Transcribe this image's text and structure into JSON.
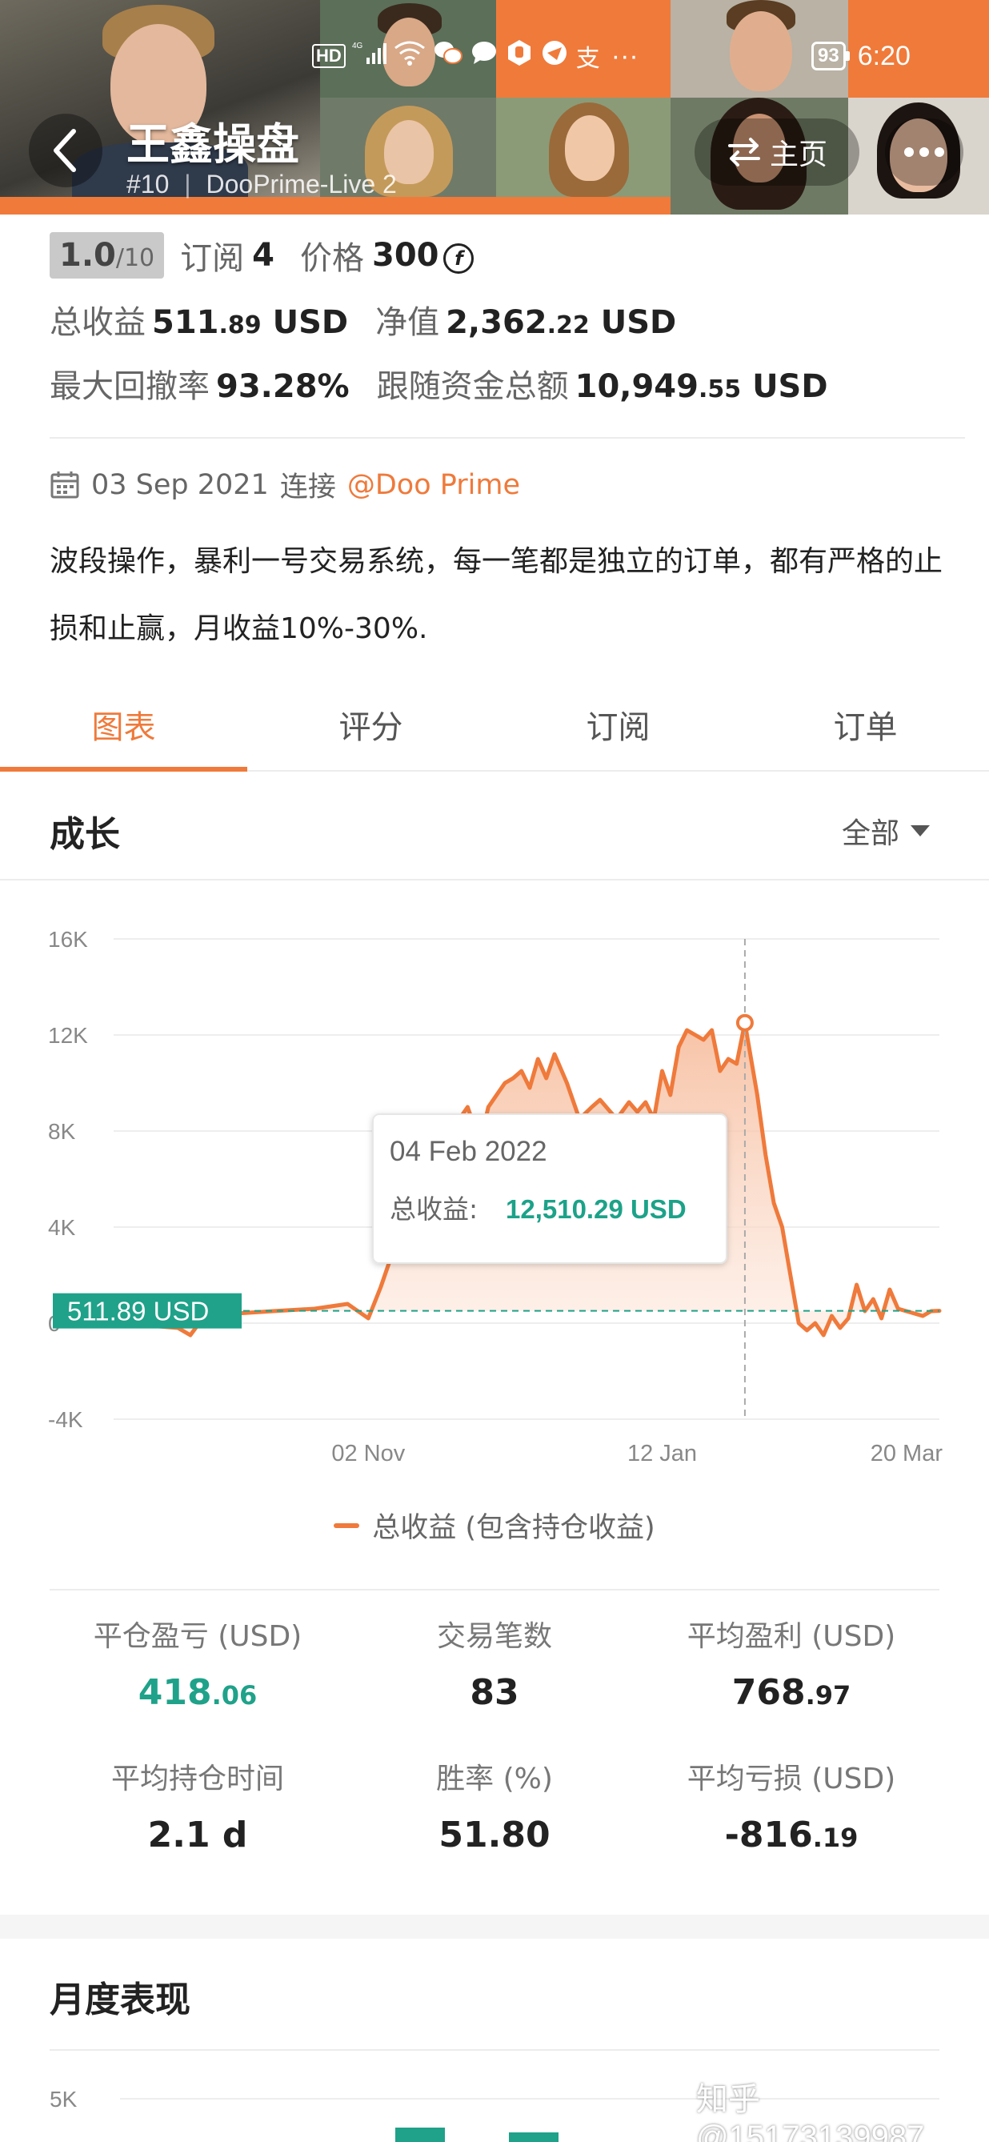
{
  "status_bar": {
    "left_icons": [
      "hd-icon",
      "4g-signal-icon",
      "wifi-icon",
      "wechat-icon",
      "message-icon",
      "hand-icon",
      "app-icon",
      "app-icon",
      "alipay-icon",
      "more-dots-icon"
    ],
    "battery": "93",
    "time": "6:20"
  },
  "header": {
    "name": "王鑫操盘",
    "rank": "#10",
    "account": "DooPrime-Live 2",
    "home_label": "主页"
  },
  "summary": {
    "rating": "1.0",
    "rating_max": "/10",
    "subscribe_label": "订阅",
    "subscribe_count": "4",
    "price_label": "价格",
    "price_value": "300",
    "total_profit_label": "总收益",
    "total_profit_int": "511",
    "total_profit_dec": ".89",
    "total_profit_unit": "USD",
    "net_value_label": "净值",
    "net_value_int": "2,362",
    "net_value_dec": ".22",
    "net_value_unit": "USD",
    "max_drawdown_label": "最大回撤率",
    "max_drawdown_value": "93.28%",
    "follow_total_label": "跟随资金总额",
    "follow_total_int": "10,949",
    "follow_total_dec": ".55",
    "follow_total_unit": "USD"
  },
  "connection": {
    "date": "03 Sep 2021",
    "connect_label": "连接",
    "broker": "@Doo Prime"
  },
  "description": "波段操作，暴利一号交易系统，每一笔都是独立的订单，都有严格的止损和止赢，月收益10%-30%.",
  "tabs": [
    {
      "label": "图表",
      "active": true
    },
    {
      "label": "评分",
      "active": false
    },
    {
      "label": "订阅",
      "active": false
    },
    {
      "label": "订单",
      "active": false
    }
  ],
  "growth": {
    "title": "成长",
    "range": "全部",
    "legend": "总收益 (包含持仓收益)"
  },
  "chart_data": {
    "type": "area",
    "title": "",
    "xlabel": "",
    "ylabel": "",
    "ylim": [
      -4000,
      16000
    ],
    "y_ticks": [
      "16K",
      "12K",
      "8K",
      "4K",
      "0",
      "-4K"
    ],
    "x_tick_labels": [
      "02 Nov",
      "12 Jan",
      "20 Mar"
    ],
    "grid": true,
    "current_value_label": "511.89 USD",
    "current_value": 511.89,
    "tooltip": {
      "date": "04 Feb 2022",
      "label": "总收益:",
      "value": "12,510.29 USD"
    },
    "series": [
      {
        "name": "总收益 (包含持仓收益)",
        "color": "#ef7a3b",
        "x": [
          "2021-09-03",
          "2021-09-10",
          "2021-09-17",
          "2021-09-20",
          "2021-09-23",
          "2021-09-26",
          "2021-10-01",
          "2021-10-10",
          "2021-10-20",
          "2021-10-28",
          "2021-11-02",
          "2021-11-05",
          "2021-11-08",
          "2021-11-12",
          "2021-11-16",
          "2021-11-20",
          "2021-11-22",
          "2021-11-24",
          "2021-11-26",
          "2021-11-29",
          "2021-12-01",
          "2021-12-03",
          "2021-12-05",
          "2021-12-07",
          "2021-12-09",
          "2021-12-11",
          "2021-12-13",
          "2021-12-15",
          "2021-12-17",
          "2021-12-20",
          "2021-12-23",
          "2021-12-26",
          "2021-12-28",
          "2022-01-01",
          "2022-01-04",
          "2022-01-06",
          "2022-01-08",
          "2022-01-10",
          "2022-01-12",
          "2022-01-14",
          "2022-01-16",
          "2022-01-18",
          "2022-01-20",
          "2022-01-22",
          "2022-01-24",
          "2022-01-26",
          "2022-01-28",
          "2022-01-30",
          "2022-02-01",
          "2022-02-04",
          "2022-02-06",
          "2022-02-08",
          "2022-02-10",
          "2022-02-12",
          "2022-02-14",
          "2022-02-16",
          "2022-02-18",
          "2022-02-20",
          "2022-02-22",
          "2022-02-24",
          "2022-02-26",
          "2022-02-28",
          "2022-03-02",
          "2022-03-04",
          "2022-03-06",
          "2022-03-08",
          "2022-03-10",
          "2022-03-12",
          "2022-03-14",
          "2022-03-16",
          "2022-03-18",
          "2022-03-20"
        ],
        "values": [
          0,
          -100,
          -200,
          -500,
          200,
          300,
          400,
          500,
          600,
          800,
          200,
          1500,
          3000,
          4500,
          5500,
          6000,
          7000,
          8500,
          9000,
          7500,
          9000,
          9500,
          10000,
          10200,
          10500,
          9800,
          11000,
          10200,
          11200,
          10000,
          8500,
          9000,
          9300,
          8500,
          9200,
          8800,
          9200,
          8500,
          10500,
          9500,
          11500,
          12200,
          12000,
          11800,
          12200,
          10500,
          11000,
          10800,
          12510,
          9500,
          7000,
          5000,
          4000,
          2000,
          0,
          -300,
          0,
          -500,
          300,
          -200,
          200,
          1600,
          500,
          1000,
          200,
          1400,
          600,
          500,
          400,
          300,
          500,
          511.89
        ]
      }
    ]
  },
  "stats": [
    {
      "label": "平仓盈亏 (USD)",
      "int": "418",
      "dec": ".06",
      "green": true
    },
    {
      "label": "交易笔数",
      "int": "83",
      "dec": "",
      "green": false
    },
    {
      "label": "平均盈利 (USD)",
      "int": "768",
      "dec": ".97",
      "green": false
    },
    {
      "label": "平均持仓时间",
      "int": "2.1 d",
      "dec": "",
      "green": false
    },
    {
      "label": "胜率 (%)",
      "int": "51.80",
      "dec": "",
      "green": false
    },
    {
      "label": "平均亏损 (USD)",
      "int": "-816",
      "dec": ".19",
      "green": false
    }
  ],
  "monthly": {
    "title": "月度表现",
    "y_tick": "5K"
  },
  "watermark": "知乎 @15173139987",
  "colors": {
    "accent": "#ef7a3b",
    "positive": "#1fa289",
    "badge_bg": "#c9c9c9"
  }
}
